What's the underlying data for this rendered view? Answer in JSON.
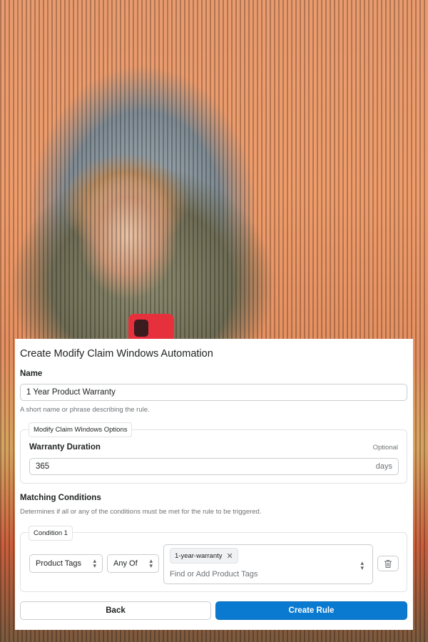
{
  "dialog": {
    "title": "Create Modify Claim Windows Automation"
  },
  "name_field": {
    "label": "Name",
    "value": "1 Year Product Warranty",
    "help": "A short name or phrase describing the rule."
  },
  "options": {
    "legend": "Modify Claim Windows Options",
    "warranty": {
      "label": "Warranty Duration",
      "optional": "Optional",
      "value": "365",
      "suffix": "days"
    }
  },
  "matching": {
    "label": "Matching Conditions",
    "help": "Determines if all or any of the conditions must be met for the rule to be triggered."
  },
  "condition": {
    "legend": "Condition 1",
    "field_select": "Product Tags",
    "operator_select": "Any Of",
    "tags": [
      "1-year-warranty"
    ],
    "tag_input_placeholder": "Find or Add Product Tags"
  },
  "footer": {
    "back": "Back",
    "create": "Create Rule"
  },
  "colors": {
    "primary": "#0a7ad1",
    "border": "#c9cccf"
  }
}
